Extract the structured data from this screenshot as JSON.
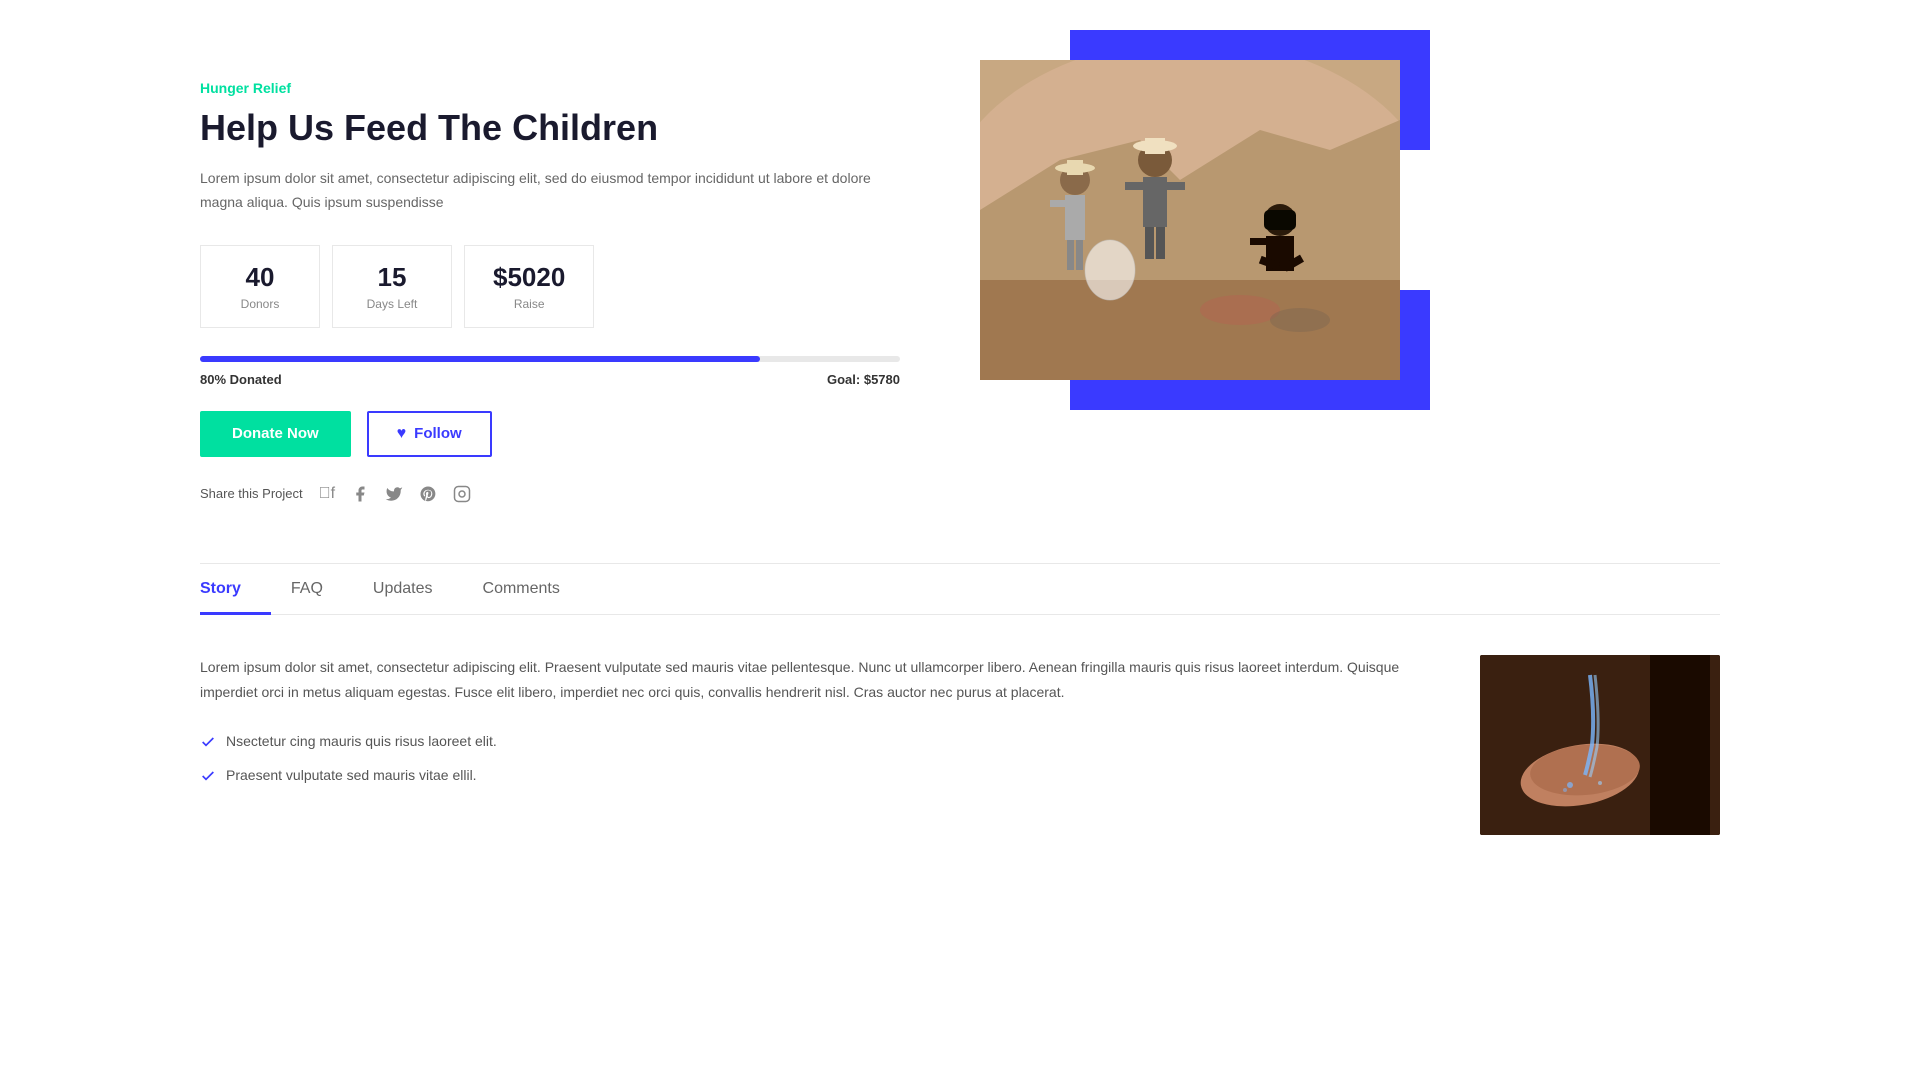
{
  "page": {
    "category": "Hunger Relief",
    "title": "Help Us Feed The Children",
    "description": "Lorem ipsum dolor sit amet, consectetur adipiscing elit, sed do eiusmod tempor incididunt ut labore et dolore magna aliqua. Quis ipsum suspendisse",
    "stats": {
      "donors": {
        "value": "40",
        "label": "Donors"
      },
      "days_left": {
        "value": "15",
        "label": "Days Left"
      },
      "raise": {
        "value": "$5020",
        "label": "Raise"
      }
    },
    "progress": {
      "percent": 80,
      "donated_label": "80% Donated",
      "goal_label": "Goal: $5780"
    },
    "buttons": {
      "donate": "Donate Now",
      "follow": "Follow"
    },
    "share": {
      "label": "Share this Project"
    },
    "tabs": [
      {
        "id": "story",
        "label": "Story",
        "active": true
      },
      {
        "id": "faq",
        "label": "FAQ",
        "active": false
      },
      {
        "id": "updates",
        "label": "Updates",
        "active": false
      },
      {
        "id": "comments",
        "label": "Comments",
        "active": false
      }
    ],
    "story": {
      "paragraph": "Lorem ipsum dolor sit amet, consectetur adipiscing elit. Praesent vulputate sed mauris vitae pellentesque. Nunc ut ullamcorper libero. Aenean fringilla mauris quis risus laoreet interdum. Quisque imperdiet orci in metus aliquam egestas. Fusce elit libero, imperdiet nec orci quis, convallis hendrerit nisl. Cras auctor nec purus at placerat.",
      "checklist": [
        "Nsectetur cing mauris quis risus laoreet elit.",
        "Praesent vulputate sed mauris vitae ellil."
      ]
    }
  },
  "colors": {
    "accent_blue": "#3a3aff",
    "accent_green": "#00e0a0",
    "text_dark": "#1a1a2e",
    "text_muted": "#666"
  }
}
